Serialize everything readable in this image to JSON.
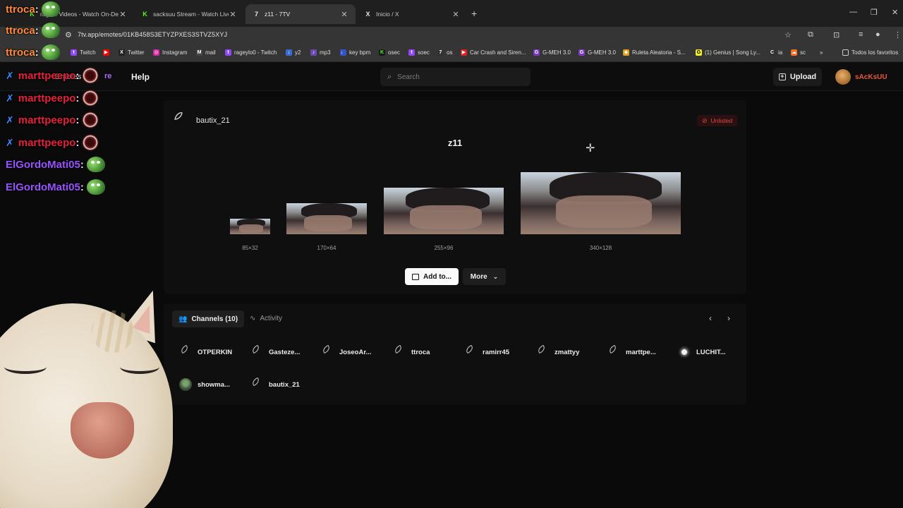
{
  "browser": {
    "tabs": [
      {
        "title": "rage... Videos - Watch On-Demand",
        "icon": "K",
        "icon_color": "#53fc18",
        "active": false
      },
      {
        "title": "sacksuu Stream - Watch Live on Kick",
        "icon": "K",
        "icon_color": "#53fc18",
        "active": false
      },
      {
        "title": "z11 - 7TV",
        "icon": "7",
        "icon_color": "#e8e8e8",
        "active": true
      },
      {
        "title": "Inicio / X",
        "icon": "X",
        "icon_color": "#e8e8e8",
        "active": false
      }
    ],
    "url": "7tv.app/emotes/01KB458S3ETYZPXES3STVZ5XYJ",
    "bookmarks": [
      {
        "label": "Twitch",
        "color": "#9146ff",
        "glyph": "t"
      },
      {
        "label": "",
        "color": "#ff0000",
        "glyph": "▶"
      },
      {
        "label": "Twitter",
        "color": "#222",
        "glyph": "X"
      },
      {
        "label": "Instagram",
        "color": "#d6249f",
        "glyph": "◎"
      },
      {
        "label": "mail",
        "color": "#444",
        "glyph": "M"
      },
      {
        "label": "rageylo0 - Twitch",
        "color": "#9146ff",
        "glyph": "t"
      },
      {
        "label": "y2",
        "color": "#3a6bd6",
        "glyph": "↓"
      },
      {
        "label": "mp3",
        "color": "#6a4ab0",
        "glyph": "♪"
      },
      {
        "label": "key bpm",
        "color": "#3355cc",
        "glyph": "♩"
      },
      {
        "label": "osec",
        "color": "#53fc18",
        "glyph": "K"
      },
      {
        "label": "soec",
        "color": "#9146ff",
        "glyph": "t"
      },
      {
        "label": "os",
        "color": "#333",
        "glyph": "7"
      },
      {
        "label": "Car Crash and Siren...",
        "color": "#e02020",
        "glyph": "▶"
      },
      {
        "label": "G-MEH 3.0",
        "color": "#7a3ac0",
        "glyph": "G"
      },
      {
        "label": "G-MEH 3.0",
        "color": "#7a3ac0",
        "glyph": "G"
      },
      {
        "label": "Ruleta Aleatoria - S...",
        "color": "#e0a020",
        "glyph": "◆"
      },
      {
        "label": "(1) Genius | Song Ly...",
        "color": "#f0f020",
        "glyph": "G"
      },
      {
        "label": "ia",
        "color": "#333",
        "glyph": "C"
      },
      {
        "label": "sc",
        "color": "#f26f23",
        "glyph": "☁"
      }
    ],
    "bookmarks_more": "»",
    "all_bookmarks": "Todos los favoritos"
  },
  "site": {
    "nav_emotes": "Emotes",
    "nav_store": "re",
    "nav_help": "Help",
    "search_placeholder": "Search",
    "upload_label": "Upload",
    "username": "sAcKsUU"
  },
  "emote": {
    "owner": "bautix_21",
    "status": "Unlisted",
    "name": "z11",
    "sizes": [
      "85×32",
      "170×64",
      "255×96",
      "340×128"
    ],
    "add_label": "Add to...",
    "more_label": "More"
  },
  "channels": {
    "tab_label": "Channels (10)",
    "activity_label": "Activity",
    "list": [
      "OTPERKIN",
      "Gasteze...",
      "JoseoAr...",
      "ttroca",
      "ramirr45",
      "zmattyy",
      "marttpe...",
      "LUCHIT...",
      "showma...",
      "bautix_21"
    ]
  },
  "chat": [
    {
      "name": "ttroca",
      "color": "orange"
    },
    {
      "name": "ttroca",
      "color": "orange"
    },
    {
      "name": "ttroca",
      "color": "orange"
    },
    {
      "name": "marttpeepo",
      "color": "red"
    },
    {
      "name": "marttpeepo",
      "color": "red"
    },
    {
      "name": "marttpeepo",
      "color": "red"
    },
    {
      "name": "marttpeepo",
      "color": "red"
    },
    {
      "name": "ElGordoMati05",
      "color": "purple"
    },
    {
      "name": "ElGordoMati05",
      "color": "purple"
    }
  ]
}
